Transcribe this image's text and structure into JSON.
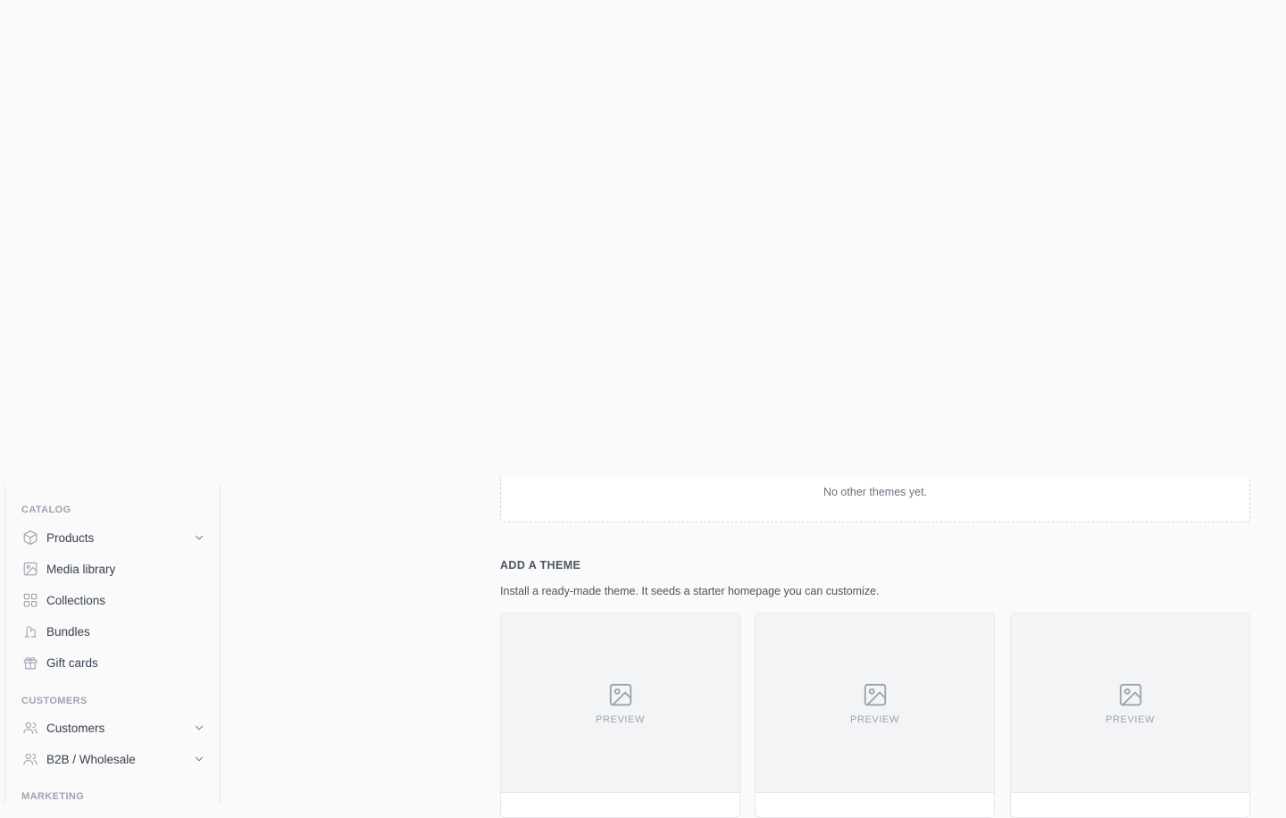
{
  "sidebar": {
    "sections": {
      "catalog": "CATALOG",
      "customers": "CUSTOMERS",
      "marketing": "MARKETING"
    },
    "items": [
      {
        "label": "Products",
        "icon": "box-icon"
      },
      {
        "label": "Media library",
        "icon": "image-icon"
      },
      {
        "label": "Collections",
        "icon": "grid-icon"
      },
      {
        "label": "Bundles",
        "icon": "bundle-icon"
      },
      {
        "label": "Gift cards",
        "icon": "gift-icon"
      },
      {
        "label": "Customers",
        "icon": "users-icon"
      },
      {
        "label": "B2B / Wholesale",
        "icon": "users-icon"
      }
    ]
  },
  "themes": {
    "empty_text": "No other themes yet.",
    "add_title": "ADD A THEME",
    "add_description": "Install a ready-made theme. It seeds a starter homepage you can customize.",
    "cards": [
      {
        "preview_label": "PREVIEW"
      },
      {
        "preview_label": "PREVIEW"
      },
      {
        "preview_label": "PREVIEW"
      }
    ]
  }
}
